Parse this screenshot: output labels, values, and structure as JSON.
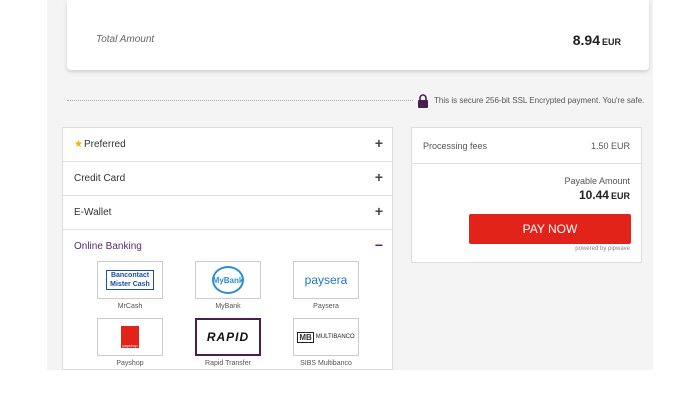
{
  "total": {
    "label": "Total Amount",
    "amount": "8.94",
    "currency": "EUR"
  },
  "secure": {
    "text": "This is secure 256-bit SSL Encrypted payment. You're safe."
  },
  "accordion": {
    "items": [
      {
        "label": "Preferred",
        "toggle": "+"
      },
      {
        "label": "Credit Card",
        "toggle": "+"
      },
      {
        "label": "E-Wallet",
        "toggle": "+"
      },
      {
        "label": "Online Banking",
        "toggle": "−"
      }
    ]
  },
  "banks": [
    {
      "name": "MrCash",
      "logo_line1": "Bancontact",
      "logo_line2": "Mister Cash"
    },
    {
      "name": "MyBank",
      "logo_text": "MyBank"
    },
    {
      "name": "Paysera",
      "logo_text": "paysera"
    },
    {
      "name": "Payshop",
      "logo_text": "payshop"
    },
    {
      "name": "Rapid Transfer",
      "logo_text": "RAPID"
    },
    {
      "name": "SIBS Multibanco",
      "logo_mb": "MB",
      "logo_text": "MULTIBANCO"
    }
  ],
  "summary": {
    "fees_label": "Processing fees",
    "fees_value": "1.50 EUR",
    "payable_label": "Payable Amount",
    "payable_amount": "10.44",
    "payable_currency": "EUR",
    "pay_label": "PAY NOW",
    "powered_by": "powered by pipwave"
  },
  "colors": {
    "accent": "#5b2a6e",
    "pay_button": "#e2231a",
    "star": "#f0b400"
  }
}
